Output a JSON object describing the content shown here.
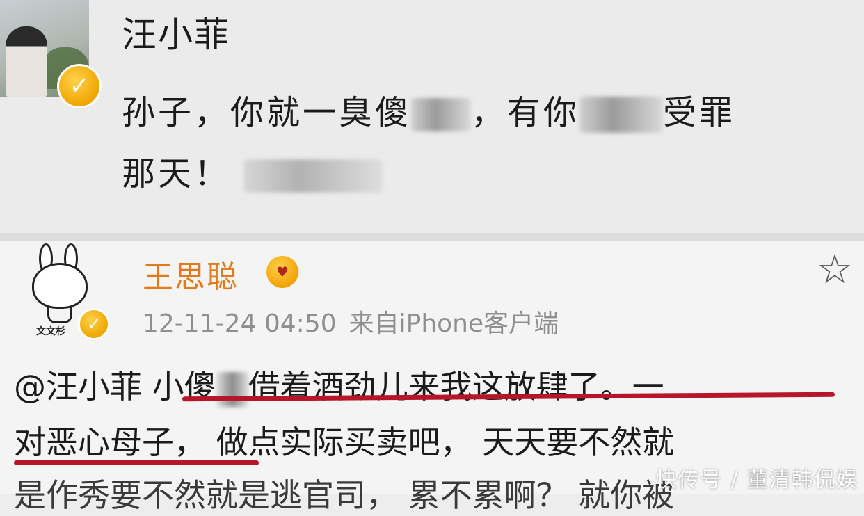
{
  "post1": {
    "author": "汪小菲",
    "line1_a": "孙子，你就一臭傻",
    "line1_b": "，有你",
    "line1_c": "受罪",
    "line2_a": "那天！",
    "verified_icon": "v-badge-icon"
  },
  "post2": {
    "author": "王思聪",
    "timestamp": "12-11-24 04:50",
    "source": "来自iPhone客户端",
    "avatar_label": "文文杉",
    "comment_line1_mention": "@汪小菲",
    "comment_line1_a": " 小傻",
    "comment_line1_b": "借着酒劲儿来我这放肆了。一",
    "comment_line2": "对恶心母子， 做点实际买卖吧， 天天要不然就",
    "comment_line3_partial": "是作秀要不然就是逃官司，  累不累啊？ 就你被",
    "highlight_color": "#b6152a",
    "name_color": "#e07a1a",
    "star_icon": "star-icon"
  },
  "watermark": "快传号 / 董清韩侃娱"
}
